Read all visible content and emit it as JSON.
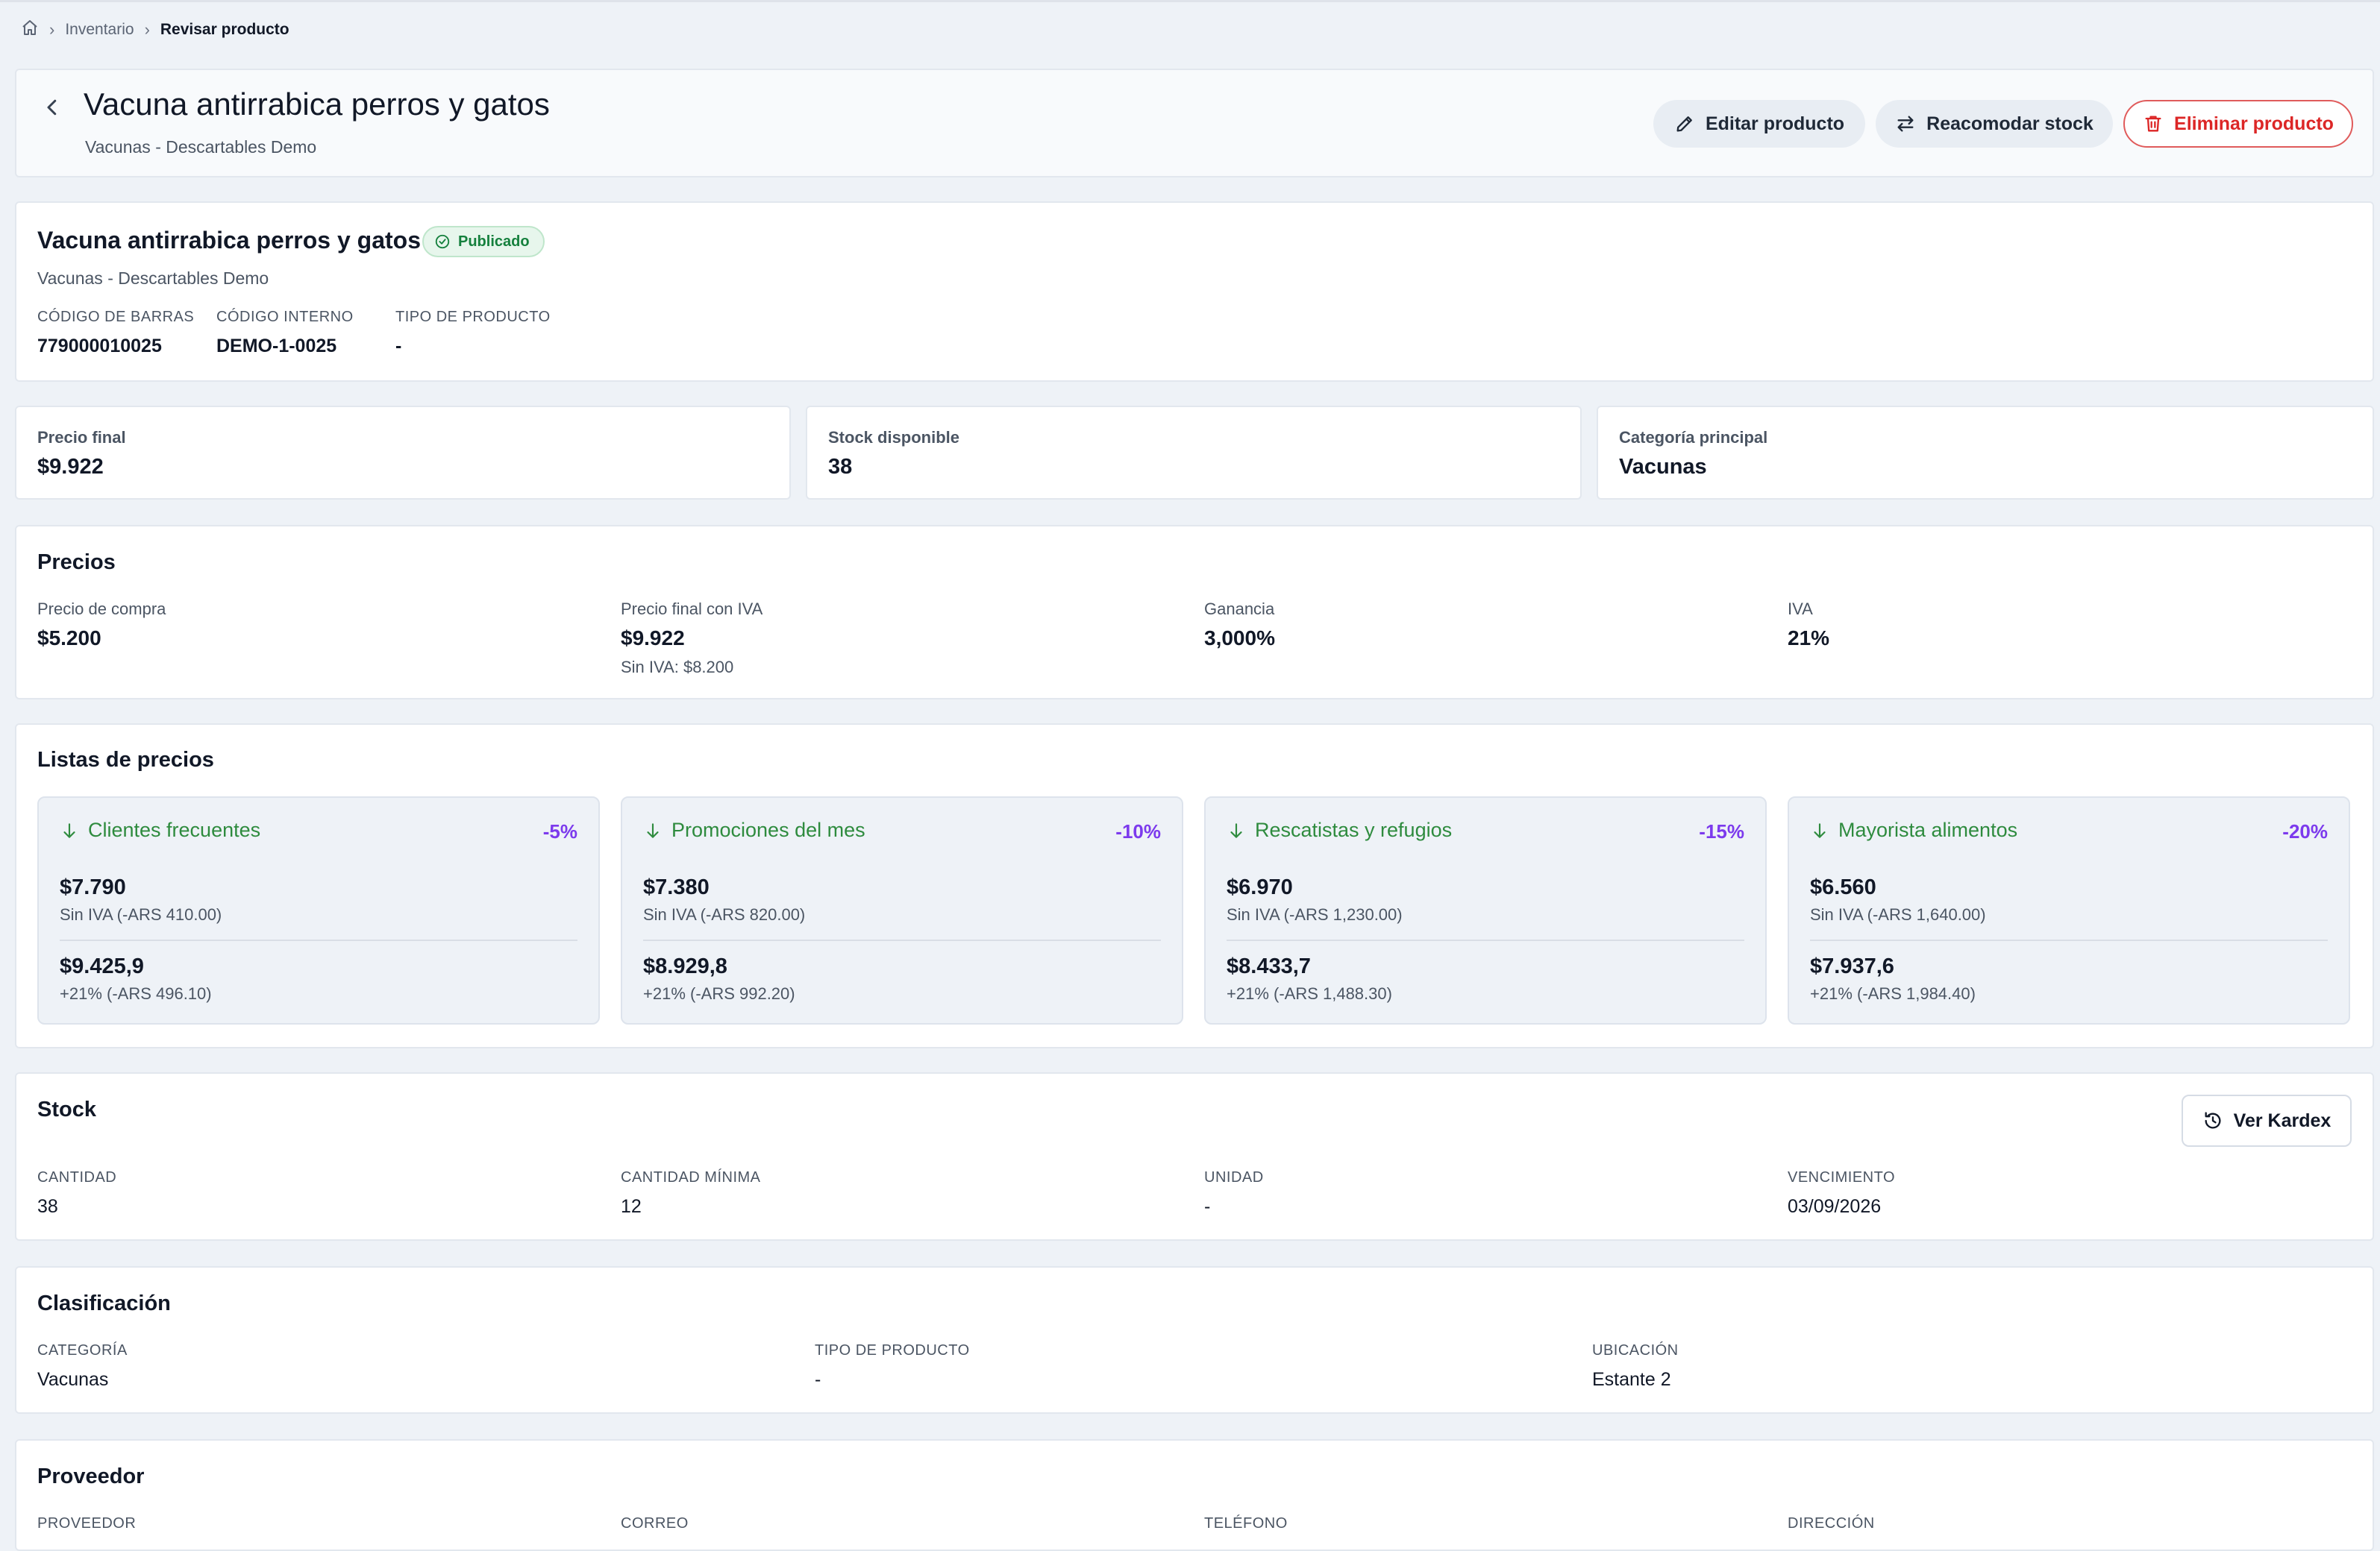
{
  "breadcrumb": {
    "items": [
      "Inventario",
      "Revisar producto"
    ]
  },
  "header": {
    "title": "Vacuna antirrabica perros y gatos",
    "subtitle": "Vacunas - Descartables Demo",
    "buttons": {
      "edit": "Editar producto",
      "restock": "Reacomodar stock",
      "delete": "Eliminar producto"
    }
  },
  "product": {
    "name": "Vacuna antirrabica perros y gatos",
    "badge": "Publicado",
    "subtitle": "Vacunas - Descartables Demo",
    "meta": [
      {
        "label": "CÓDIGO DE BARRAS",
        "value": "779000010025"
      },
      {
        "label": "CÓDIGO INTERNO",
        "value": "DEMO-1-0025"
      },
      {
        "label": "TIPO DE PRODUCTO",
        "value": "-"
      }
    ]
  },
  "summary": [
    {
      "label": "Precio final",
      "value": "$9.922"
    },
    {
      "label": "Stock disponible",
      "value": "38"
    },
    {
      "label": "Categoría principal",
      "value": "Vacunas"
    }
  ],
  "prices": {
    "title": "Precios",
    "fields": [
      {
        "label": "Precio de compra",
        "value": "$5.200"
      },
      {
        "label": "Precio final con IVA",
        "value": "$9.922",
        "note": "Sin IVA: $8.200"
      },
      {
        "label": "Ganancia",
        "value": "3,000%"
      },
      {
        "label": "IVA",
        "value": "21%"
      }
    ]
  },
  "price_lists": {
    "title": "Listas de precios",
    "items": [
      {
        "name": "Clientes frecuentes",
        "pct": "-5%",
        "v1": "$7.790",
        "n1": "Sin IVA (-ARS 410.00)",
        "v2": "$9.425,9",
        "n2": "+21% (-ARS 496.10)"
      },
      {
        "name": "Promociones del mes",
        "pct": "-10%",
        "v1": "$7.380",
        "n1": "Sin IVA (-ARS 820.00)",
        "v2": "$8.929,8",
        "n2": "+21% (-ARS 992.20)"
      },
      {
        "name": "Rescatistas y refugios",
        "pct": "-15%",
        "v1": "$6.970",
        "n1": "Sin IVA (-ARS 1,230.00)",
        "v2": "$8.433,7",
        "n2": "+21% (-ARS 1,488.30)"
      },
      {
        "name": "Mayorista alimentos",
        "pct": "-20%",
        "v1": "$6.560",
        "n1": "Sin IVA (-ARS 1,640.00)",
        "v2": "$7.937,6",
        "n2": "+21% (-ARS 1,984.40)"
      }
    ]
  },
  "stock": {
    "title": "Stock",
    "kardex_label": "Ver Kardex",
    "fields": [
      {
        "label": "CANTIDAD",
        "value": "38"
      },
      {
        "label": "CANTIDAD MÍNIMA",
        "value": "12"
      },
      {
        "label": "UNIDAD",
        "value": "-"
      },
      {
        "label": "VENCIMIENTO",
        "value": "03/09/2026"
      }
    ]
  },
  "classification": {
    "title": "Clasificación",
    "fields": [
      {
        "label": "CATEGORÍA",
        "value": "Vacunas"
      },
      {
        "label": "TIPO DE PRODUCTO",
        "value": "-"
      },
      {
        "label": "UBICACIÓN",
        "value": "Estante 2"
      }
    ]
  },
  "supplier": {
    "title": "Proveedor",
    "fields": [
      {
        "label": "PROVEEDOR"
      },
      {
        "label": "CORREO"
      },
      {
        "label": "TELÉFONO"
      },
      {
        "label": "DIRECCIÓN"
      }
    ]
  },
  "colors": {
    "background": "#eef2f7",
    "published_green": "#15803d",
    "list_green": "#2e8b3e",
    "discount_purple": "#7c3aed",
    "danger_red": "#dc2626"
  },
  "icons": [
    "home-icon",
    "chevron-right-icon",
    "chevron-left-icon",
    "pencil-icon",
    "swap-arrows-icon",
    "trash-icon",
    "check-circle-icon",
    "arrow-down-icon",
    "history-icon"
  ]
}
